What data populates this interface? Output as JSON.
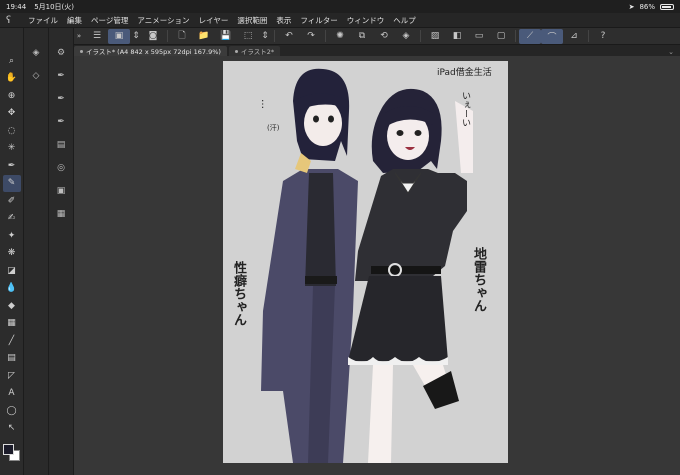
{
  "status": {
    "time": "19:44",
    "date": "5月10日(火)",
    "battery": "86%",
    "battery_level": 0.86
  },
  "menu": {
    "items": [
      "ファイル",
      "編集",
      "ページ管理",
      "アニメーション",
      "レイヤー",
      "選択範囲",
      "表示",
      "フィルター",
      "ウィンドウ",
      "ヘルプ"
    ]
  },
  "tabs": [
    {
      "label": "イラスト* (A4 842 x 595px 72dpi 167.9%)",
      "active": true
    },
    {
      "label": "イラスト2*",
      "active": false
    }
  ],
  "canvas_text": {
    "top_right": "iPad借金生活",
    "say_left": "…",
    "say_left_small": "(汗)",
    "say_right": "いぇーい",
    "name_left": "性癖ちゃん",
    "name_right": "地雷ちゃん"
  },
  "colors": {
    "accent": "#4a5a7a",
    "canvas": "#d2d2d2",
    "workspace": "#373737"
  }
}
